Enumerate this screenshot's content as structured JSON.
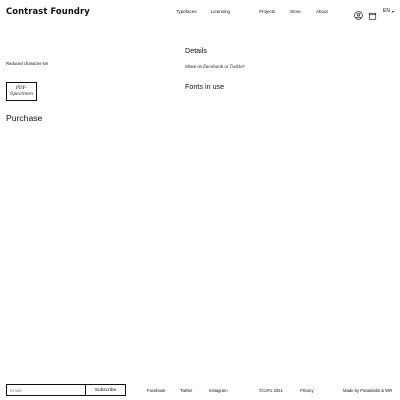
{
  "header": {
    "logo": {
      "part1": "Contrast ",
      "part2": "Foundry"
    },
    "nav": [
      "Typefaces",
      "Licensing",
      "Projects",
      "Store",
      "About"
    ],
    "language": "EN",
    "icons": {
      "account": "user-circle-icon",
      "cart": "shopping-bag-icon",
      "caret": "caret-down-icon"
    }
  },
  "left": {
    "reduced_charset": "Reduced character set",
    "pdf_specimen": {
      "line1": "PDF-",
      "line2": "Specimen"
    },
    "purchase": "Purchase"
  },
  "right": {
    "details": "Details",
    "share": {
      "prefix": "Share on ",
      "facebook": "Facebook",
      "or": " or ",
      "twitter": "Twitter"
    },
    "fonts_in_use": "Fonts in use"
  },
  "footer": {
    "email_placeholder": "Email",
    "subscribe": "Subscribe",
    "links": {
      "facebook": "Facebook",
      "twitter": "Twitter",
      "instagram": "Instagram",
      "copyright": "©CoFo 2021",
      "privacy": "Privacy",
      "credit": "Made by Potatolabs & WR"
    }
  }
}
